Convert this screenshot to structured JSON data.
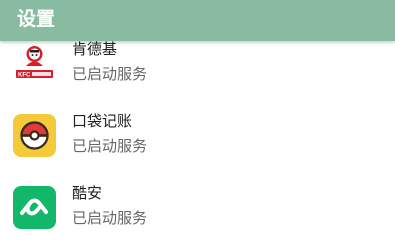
{
  "appbar": {
    "title": "设置"
  },
  "apps": [
    {
      "name": "肯德基",
      "status": "已启动服务",
      "icon": "kfc-app-icon",
      "icon_caption": "KFC肯德基"
    },
    {
      "name": "口袋记账",
      "status": "已启动服务",
      "icon": "pocket-ledger-app-icon"
    },
    {
      "name": "酷安",
      "status": "已启动服务",
      "icon": "coolapk-app-icon"
    }
  ],
  "colors": {
    "appbar": "#88bba0",
    "pocket_icon_bg": "#f4c93a",
    "coolapk_icon_bg": "#12b76a",
    "kfc_red": "#d61f2a"
  }
}
